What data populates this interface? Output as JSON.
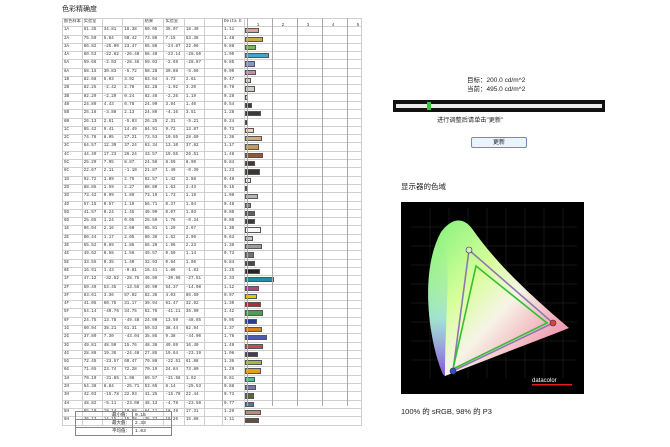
{
  "page_title": "色彩精确度",
  "table": {
    "headers": [
      "颜色样本",
      "实验室",
      "",
      "",
      "结果",
      "实验室",
      "",
      "",
      "Delta E"
    ],
    "header_scale": [
      "1",
      "2",
      "3",
      "4",
      "5"
    ],
    "rows": [
      [
        "1A",
        "61.35",
        "34.81",
        "18.38",
        "60.05",
        "35.07",
        "18.40",
        "1.11",
        "#d9a59a"
      ],
      [
        "2A",
        "75.50",
        "5.84",
        "50.42",
        "73.88",
        "7.15",
        "53.38",
        "1.48",
        "#d0a650"
      ],
      [
        "3A",
        "66.82",
        "-25.00",
        "23.47",
        "65.88",
        "-24.87",
        "22.96",
        "0.88",
        "#7fb55a"
      ],
      [
        "4A",
        "60.53",
        "-22.62",
        "-26.40",
        "58.40",
        "-23.14",
        "-28.50",
        "1.90",
        "#4ba4c8"
      ],
      [
        "5A",
        "59.66",
        "-2.03",
        "-28.46",
        "59.03",
        "-2.69",
        "-28.87",
        "0.85",
        "#7f98c6"
      ],
      [
        "6A",
        "58.15",
        "30.83",
        "-5.72",
        "58.28",
        "30.88",
        "-5.66",
        "0.90",
        "#cc8aaa"
      ],
      [
        "1B",
        "82.68",
        "5.03",
        "3.92",
        "83.64",
        "4.73",
        "2.61",
        "0.47",
        "#e3d3cf"
      ],
      [
        "2B",
        "82.25",
        "-2.42",
        "2.78",
        "82.28",
        "-1.92",
        "3.20",
        "0.78",
        "#cfd0c8"
      ],
      [
        "3B",
        "82.29",
        "-2.29",
        "0.24",
        "82.48",
        "-2.26",
        "1.19",
        "0.28",
        "#cacdcb"
      ],
      [
        "4B",
        "24.89",
        "4.43",
        "0.78",
        "24.99",
        "3.94",
        "1.40",
        "0.54",
        "#3f3a39"
      ],
      [
        "5B",
        "25.16",
        "-3.88",
        "2.13",
        "24.89",
        "-4.16",
        "3.51",
        "1.28",
        "#363d36"
      ],
      [
        "6B",
        "26.13",
        "2.61",
        "-5.03",
        "26.25",
        "2.31",
        "-5.21",
        "0.24",
        "#3a3a46"
      ],
      [
        "1C",
        "85.42",
        "9.41",
        "14.49",
        "84.91",
        "9.72",
        "13.87",
        "0.73",
        "#f0d2bd"
      ],
      [
        "2C",
        "74.78",
        "8.05",
        "27.21",
        "73.53",
        "10.55",
        "28.60",
        "1.38",
        "#d7aa7a"
      ],
      [
        "3C",
        "64.57",
        "12.39",
        "37.24",
        "63.34",
        "13.10",
        "37.82",
        "1.17",
        "#c69c5e"
      ],
      [
        "4C",
        "44.49",
        "17.23",
        "26.24",
        "43.57",
        "19.55",
        "26.51",
        "1.48",
        "#8a5a3d"
      ],
      [
        "5C",
        "25.29",
        "7.95",
        "8.87",
        "24.56",
        "8.59",
        "8.90",
        "0.84",
        "#4a3530"
      ],
      [
        "6C",
        "22.67",
        "2.11",
        "-1.10",
        "21.87",
        "1.49",
        "-0.39",
        "1.23",
        "#383536"
      ],
      [
        "1D",
        "92.72",
        "1.89",
        "2.76",
        "92.57",
        "1.42",
        "2.88",
        "0.48",
        "#f1ecea"
      ],
      [
        "2D",
        "88.85",
        "1.59",
        "2.27",
        "88.80",
        "1.63",
        "2.43",
        "0.15",
        "#e6dfdc"
      ],
      [
        "3D",
        "73.42",
        "0.99",
        "1.89",
        "73.19",
        "1.73",
        "1.19",
        "1.08",
        "#bbb4b1"
      ],
      [
        "4D",
        "57.15",
        "0.57",
        "1.19",
        "56.71",
        "0.37",
        "1.04",
        "0.48",
        "#8b8785"
      ],
      [
        "5D",
        "41.57",
        "0.24",
        "1.45",
        "40.99",
        "0.07",
        "1.03",
        "0.80",
        "#625f5d"
      ],
      [
        "6D",
        "25.65",
        "1.24",
        "0.05",
        "25.59",
        "1.76",
        "-0.34",
        "0.80",
        "#3c393a"
      ],
      [
        "1E",
        "96.04",
        "2.16",
        "2.60",
        "95.91",
        "1.29",
        "2.67",
        "1.30",
        "#fbf8f5"
      ],
      [
        "2E",
        "80.44",
        "1.17",
        "2.05",
        "80.39",
        "1.62",
        "2.06",
        "0.63",
        "#c9c5c2"
      ],
      [
        "3E",
        "65.52",
        "0.69",
        "1.86",
        "65.29",
        "1.96",
        "2.23",
        "1.38",
        "#a09a96"
      ],
      [
        "4E",
        "49.62",
        "0.58",
        "1.56",
        "49.57",
        "0.59",
        "1.14",
        "0.73",
        "#757270"
      ],
      [
        "5E",
        "33.55",
        "0.35",
        "1.40",
        "32.93",
        "0.94",
        "1.06",
        "0.84",
        "#4b4948"
      ],
      [
        "6E",
        "16.91",
        "1.43",
        "-0.81",
        "16.41",
        "1.86",
        "-1.83",
        "1.25",
        "#262426"
      ],
      [
        "1F",
        "47.12",
        "-32.52",
        "-28.75",
        "46.99",
        "-30.96",
        "-27.51",
        "2.33",
        "#208fa4"
      ],
      [
        "2F",
        "50.49",
        "53.45",
        "-13.55",
        "49.90",
        "54.37",
        "-14.08",
        "1.12",
        "#b0487e"
      ],
      [
        "3F",
        "83.61",
        "3.36",
        "87.02",
        "82.36",
        "4.03",
        "86.60",
        "0.97",
        "#e8c800"
      ],
      [
        "4F",
        "41.05",
        "60.75",
        "31.17",
        "39.94",
        "61.47",
        "32.92",
        "1.30",
        "#b52a3a"
      ],
      [
        "5F",
        "54.14",
        "-40.76",
        "34.75",
        "52.76",
        "-41.11",
        "35.90",
        "1.42",
        "#4ba14b"
      ],
      [
        "6F",
        "24.75",
        "13.78",
        "-49.48",
        "24.00",
        "13.59",
        "-48.85",
        "0.95",
        "#2a3e8a"
      ],
      [
        "1G",
        "60.94",
        "38.21",
        "61.31",
        "59.53",
        "38.44",
        "62.94",
        "1.37",
        "#d38325"
      ],
      [
        "2G",
        "37.80",
        "7.30",
        "-43.04",
        "35.85",
        "9.38",
        "-44.90",
        "1.78",
        "#4d5da7"
      ],
      [
        "3G",
        "49.81",
        "48.50",
        "15.76",
        "48.38",
        "49.69",
        "16.40",
        "1.48",
        "#b8505c"
      ],
      [
        "4G",
        "28.88",
        "19.36",
        "-24.48",
        "27.85",
        "19.64",
        "-23.19",
        "1.06",
        "#4a3468"
      ],
      [
        "5G",
        "72.45",
        "-23.57",
        "60.47",
        "70.88",
        "-22.51",
        "61.88",
        "1.36",
        "#9dbb3e"
      ],
      [
        "6G",
        "71.65",
        "23.74",
        "72.28",
        "70.19",
        "24.84",
        "73.80",
        "1.29",
        "#e6a01c"
      ],
      [
        "1H",
        "70.19",
        "-31.85",
        "1.98",
        "69.57",
        "-31.56",
        "1.62",
        "0.81",
        "#5ebb91"
      ],
      [
        "2H",
        "54.38",
        "8.84",
        "-25.71",
        "53.65",
        "8.14",
        "-25.53",
        "0.88",
        "#7a7aa4"
      ],
      [
        "3H",
        "42.03",
        "-15.78",
        "22.93",
        "41.25",
        "-15.78",
        "22.44",
        "0.73",
        "#56693a"
      ],
      [
        "4H",
        "48.82",
        "-5.11",
        "-23.08",
        "48.13",
        "-4.78",
        "-23.58",
        "0.77",
        "#5b7597"
      ],
      [
        "5H",
        "65.10",
        "18.14",
        "18.68",
        "64.11",
        "18.49",
        "17.31",
        "1.29",
        "#be8a79"
      ],
      [
        "6H",
        "36.13",
        "14.15",
        "15.78",
        "35.27",
        "15.26",
        "15.88",
        "1.11",
        "#6e4a40"
      ]
    ],
    "summary": [
      {
        "label": "最小值：",
        "value": "0.15"
      },
      {
        "label": "最大值：",
        "value": "2.33"
      },
      {
        "label": "平均值：",
        "value": "1.03"
      }
    ]
  },
  "target": {
    "target_label": "目标：",
    "target_value": "200.0 cd/m^2",
    "current_label": "当前：",
    "current_value": "495.0 cd/m^2",
    "slider_level": 0.15,
    "hint": "进行调整后请单击\"更新\"",
    "update_button": "更新"
  },
  "gamut": {
    "title": "显示器的色域",
    "brand": "datacolor",
    "caption": "100% 的 sRGB, 98% 的 P3",
    "colors": {
      "panel": "#000000",
      "grid": "#2a2a2a",
      "srgb": "#30c030",
      "display": "#8a7ab0"
    }
  }
}
